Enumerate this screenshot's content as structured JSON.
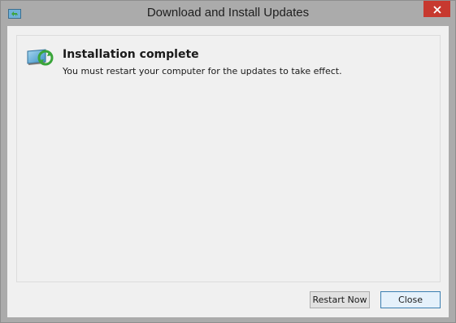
{
  "window": {
    "title": "Download and Install Updates",
    "accent_color": "#c7392f"
  },
  "icons": {
    "title_icon": "windows-update-icon",
    "close_icon": "close-icon",
    "status_icon": "update-complete-icon"
  },
  "content": {
    "heading": "Installation complete",
    "message": "You must restart your computer for the updates to take effect."
  },
  "buttons": {
    "restart_label": "Restart Now",
    "close_label": "Close"
  }
}
